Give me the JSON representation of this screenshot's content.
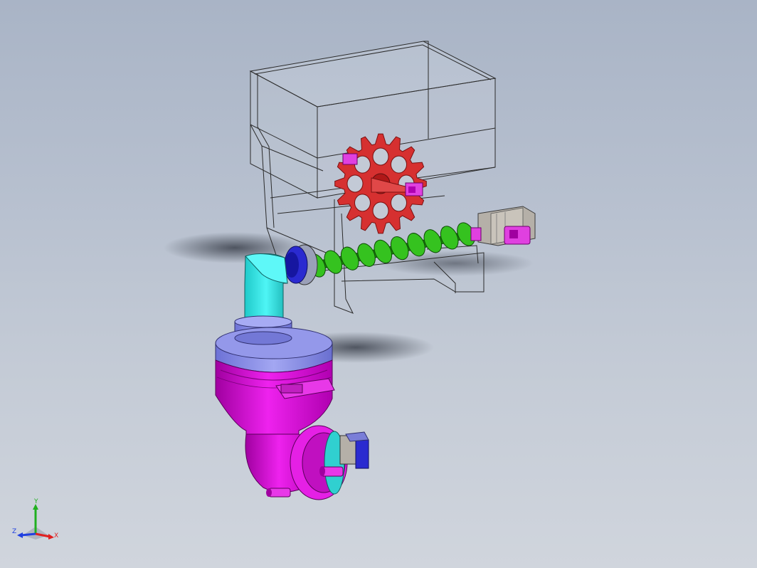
{
  "viewport": {
    "name": "cad-3d-viewport",
    "model": "hopper-screw-feeder-assembly"
  },
  "colors": {
    "background_top": "#a9b4c6",
    "background_bottom": "#d0d5dd",
    "hopper_wireframe": "#2b2b2b",
    "hopper_fill": "#c9cfd9",
    "agitator_wheel": "#d63030",
    "auger_screw": "#35c21f",
    "elbow_pipe": "#27e3e3",
    "collar_lavender": "#8a8fe8",
    "housing_magenta": "#e010e0",
    "mount_blocks": "#e040e0",
    "flange_blue": "#2a2ad0",
    "motor_grey": "#b5b0a8"
  },
  "triad": {
    "x_label": "X",
    "y_label": "Y",
    "z_label": "Z",
    "x_color": "#e02020",
    "y_color": "#20b020",
    "z_color": "#2040e0"
  }
}
